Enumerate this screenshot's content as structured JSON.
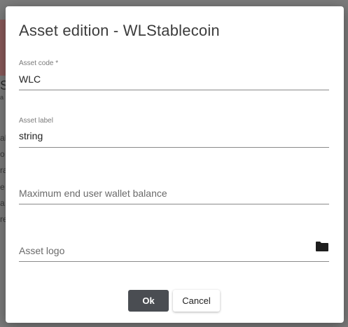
{
  "background": {
    "partial_big": "S",
    "partial_lines": [
      "a",
      "al",
      "o",
      "ra",
      "e",
      "a",
      "o",
      "re"
    ]
  },
  "dialog": {
    "title": "Asset edition - WLStablecoin",
    "fields": {
      "asset_code": {
        "label": "Asset code *",
        "value": "WLC"
      },
      "asset_label": {
        "label": "Asset label",
        "value": "string"
      },
      "max_balance": {
        "placeholder": "Maximum end user wallet balance"
      },
      "asset_logo": {
        "placeholder": "Asset logo",
        "icon": "folder-icon"
      }
    },
    "buttons": {
      "ok": "Ok",
      "cancel": "Cancel"
    }
  },
  "colors": {
    "primary_button": "#4a4d52",
    "overlay": "#7b7b7b"
  }
}
